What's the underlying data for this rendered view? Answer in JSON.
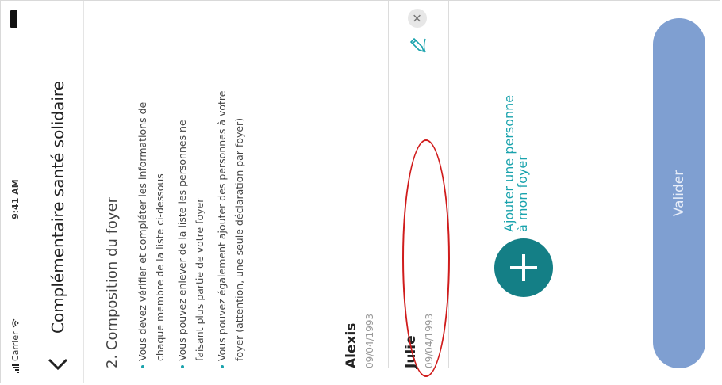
{
  "status_bar": {
    "carrier": "Carrier",
    "time": "9:41 AM"
  },
  "header": {
    "back_icon": "chevron-left-icon",
    "title": "Complémentaire santé solidaire"
  },
  "section": {
    "title": "2. Composition du foyer",
    "bullets": [
      "Vous devez vérifier et compléter les informations de chaque membre de la liste ci-dessous",
      "Vous pouvez enlever de la liste les personnes ne faisant plus partie de votre foyer",
      "Vous pouvez également ajouter des personnes à votre foyer (attention, une seule déclaration par foyer)"
    ]
  },
  "persons": [
    {
      "name": "Alexis",
      "birthdate": "09/04/1993",
      "show_actions": false
    },
    {
      "name": "Julie",
      "birthdate": "09/04/1993",
      "show_actions": true
    }
  ],
  "add_person": {
    "label_line1": "Ajouter une personne",
    "label_line2": "à mon foyer",
    "icon": "plus-icon"
  },
  "validate_button": {
    "label": "Valider"
  },
  "colors": {
    "accent": "#1aa3ad",
    "add_button": "#147f86",
    "validate_button": "#7f9fd1",
    "annotation": "#d01c1c"
  }
}
